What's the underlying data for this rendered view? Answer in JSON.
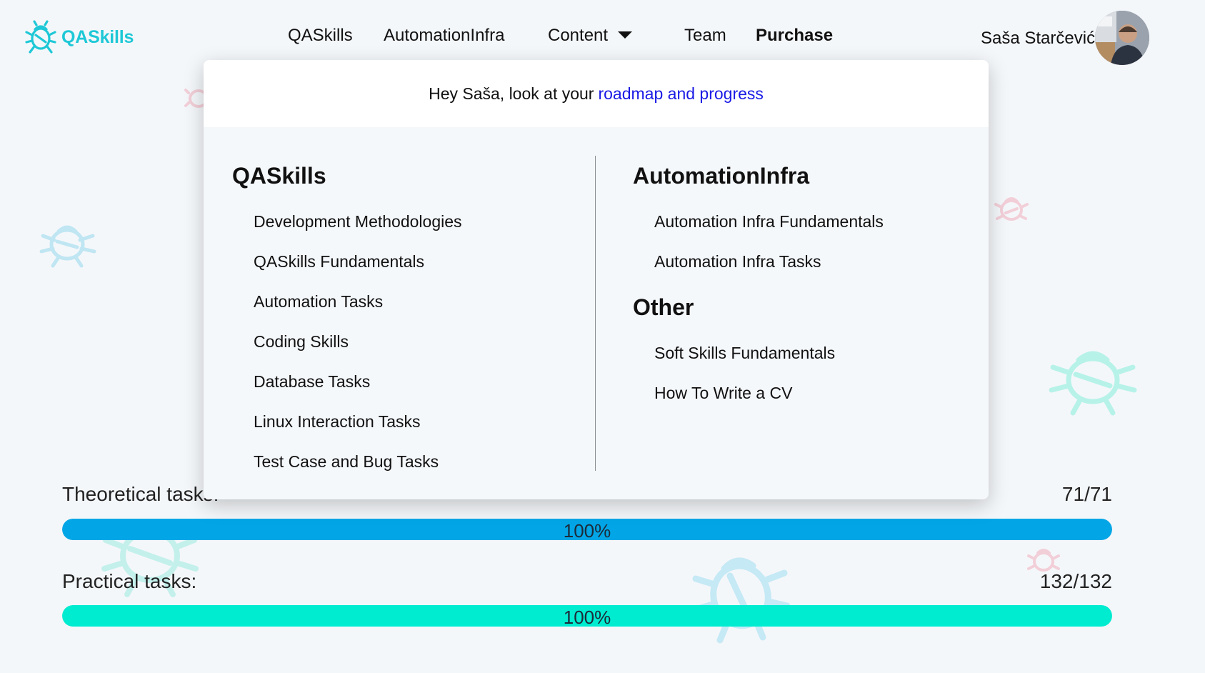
{
  "colors": {
    "brand": "#1ec8d6",
    "link": "#1a1ae6",
    "theory_bar": "#02a6e6",
    "practice_bar": "#00ecd0"
  },
  "header": {
    "logo_text": "QASkills",
    "nav": [
      "QASkills",
      "AutomationInfra",
      "Content",
      "Team",
      "Purchase"
    ],
    "user_name": "Saša Starčević"
  },
  "dropdown": {
    "greeting": "Hey Saša, look at your",
    "greeting_link": "roadmap and progress",
    "qaskills": {
      "title": "QASkills",
      "items": [
        "Development Methodologies",
        "QASkills Fundamentals",
        "Automation Tasks",
        "Coding Skills",
        "Database Tasks",
        "Linux Interaction Tasks",
        "Test Case and Bug Tasks"
      ]
    },
    "automation": {
      "title": "AutomationInfra",
      "items": [
        "Automation Infra Fundamentals",
        "Automation Infra Tasks"
      ]
    },
    "other": {
      "title": "Other",
      "items": [
        "Soft Skills Fundamentals",
        "How To Write a CV"
      ]
    }
  },
  "progress": {
    "theoretical": {
      "label": "Theoretical tasks:",
      "count": "71/71",
      "percent_text": "100%",
      "value": 1.0
    },
    "practical": {
      "label": "Practical tasks:",
      "count": "132/132",
      "percent_text": "100%",
      "value": 1.0
    }
  }
}
